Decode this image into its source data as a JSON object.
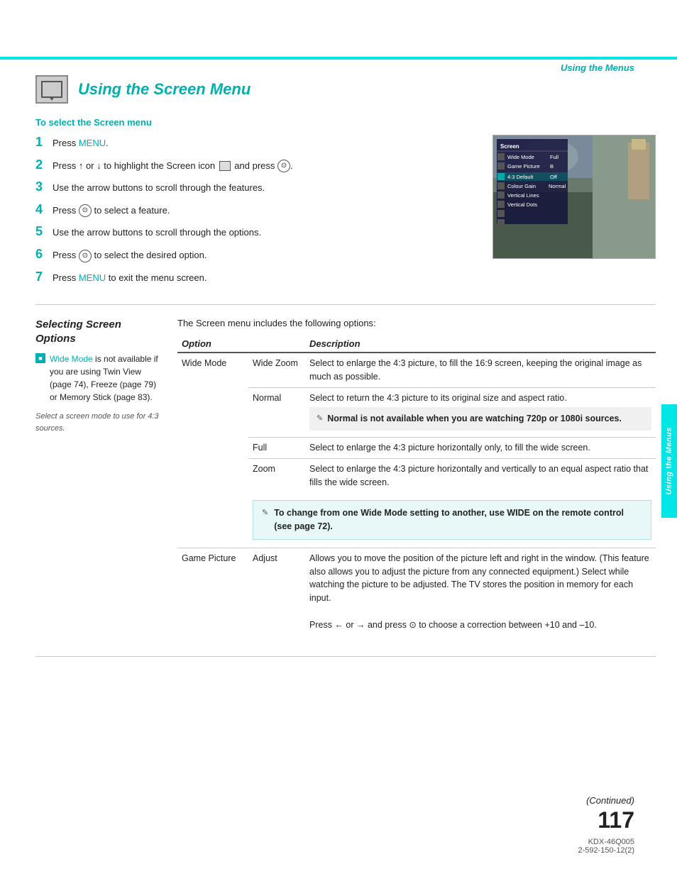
{
  "header": {
    "top_label": "Using the Menus"
  },
  "title": {
    "text": "Using the Screen Menu"
  },
  "to_select": {
    "label": "To select the Screen menu"
  },
  "steps": [
    {
      "num": "1",
      "text": "Press MENU.",
      "has_menu_link": true
    },
    {
      "num": "2",
      "text": "Press ↑ or ↓ to highlight the Screen icon  and press  .",
      "has_circle": true
    },
    {
      "num": "3",
      "text": "Use the arrow buttons to scroll through the features."
    },
    {
      "num": "4",
      "text": "Press  to select a feature.",
      "has_circle": true
    },
    {
      "num": "5",
      "text": "Use the arrow buttons to scroll through the options."
    },
    {
      "num": "6",
      "text": "Press  to select the desired option.",
      "has_circle": true
    },
    {
      "num": "7",
      "text": "Press MENU to exit the menu screen.",
      "has_menu_link": true
    }
  ],
  "screenshot": {
    "menu_title": "Screen",
    "rows": [
      {
        "label": "Wide Mode",
        "value": "Full",
        "active": false
      },
      {
        "label": "Game Picture",
        "value": "B",
        "active": false
      },
      {
        "label": "4:3 Default",
        "value": "Off",
        "active": true
      },
      {
        "label": "Colour Gain",
        "value": "Normal",
        "active": false
      },
      {
        "label": "Vertical Lines",
        "value": "",
        "active": false
      },
      {
        "label": "Vertical Dots",
        "value": "",
        "active": false
      }
    ]
  },
  "selecting": {
    "section_title": "Selecting Screen Options",
    "intro": "The Screen menu includes the following options:",
    "sidebar_note_link": "Wide Mode",
    "sidebar_note_text": " is not available if you are using Twin View (page 74), Freeze (page 79) or Memory Stick (page 83).",
    "sidebar_italic": "Select a screen mode to use for 4:3 sources.",
    "table": {
      "col1_header": "Option",
      "col2_header": "Description",
      "rows": [
        {
          "option": "Wide Mode",
          "sub_option": "",
          "sub_name": "Wide Zoom",
          "description": "Select to enlarge the 4:3 picture, to fill the 16:9 screen, keeping the original image as much as possible.",
          "has_sub": true
        },
        {
          "option": "",
          "sub_option": "Normal",
          "sub_name": "",
          "description": "Select to return the 4:3 picture to its original size and aspect ratio.",
          "has_sub": false,
          "has_note": true,
          "note_text": "Normal is not available when you are watching 720p or 1080i sources."
        },
        {
          "option": "",
          "sub_option": "Full",
          "description": "Select to enlarge the 4:3 picture horizontally only, to fill the wide screen.",
          "has_sub": false
        },
        {
          "option": "",
          "sub_option": "Zoom",
          "description": "Select to enlarge the 4:3 picture horizontally and vertically to an equal aspect ratio that fills the wide screen.",
          "has_sub": false
        }
      ],
      "wide_note": "To change from one Wide Mode setting to another, use WIDE on the remote control (see page 72).",
      "game_picture_row": {
        "option": "Game Picture",
        "sub_option": "Adjust",
        "description": "Allows you to move the position of the picture left and right in the window. (This feature also allows you to adjust the picture from any connected equipment.) Select while watching the picture to be adjusted. The TV stores the position in memory for each input.",
        "extra": "Press ← or → and press  to choose a correction between +10 and –10."
      }
    }
  },
  "footer": {
    "continued": "(Continued)",
    "page_number": "117",
    "model1": "KDX-46Q005",
    "model2": "2-592-150-12(2)"
  },
  "right_tab": {
    "text": "Using the Menus"
  }
}
